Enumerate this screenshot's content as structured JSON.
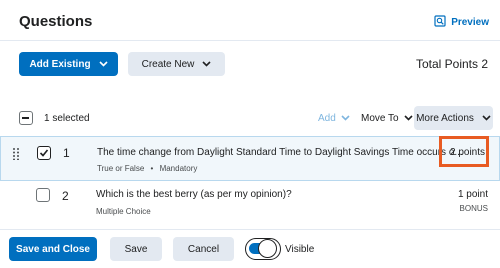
{
  "header": {
    "title": "Questions",
    "preview_label": "Preview"
  },
  "toolbar": {
    "add_existing_label": "Add Existing",
    "create_new_label": "Create New",
    "total_points": "Total Points 2"
  },
  "selection": {
    "selected_text": "1 selected",
    "add_label": "Add",
    "move_to_label": "Move To",
    "more_actions_label": "More Actions"
  },
  "questions": [
    {
      "number": "1",
      "text": "The time change from Daylight Standard Time to Daylight Savings Time occurs o...",
      "type": "True or False",
      "meta": "Mandatory",
      "points": "2 points",
      "checked": true
    },
    {
      "number": "2",
      "text": "Which is the best berry (as per my opinion)?",
      "type": "Multiple Choice",
      "points": "1 point",
      "bonus": "BONUS",
      "checked": false
    }
  ],
  "footer": {
    "save_close_label": "Save and Close",
    "save_label": "Save",
    "cancel_label": "Cancel",
    "visible_label": "Visible",
    "visible_on": true
  },
  "colors": {
    "primary": "#006fbf",
    "secondary": "#e3e9f1",
    "highlight": "#e85b22",
    "selected_row": "#f1f7fb"
  }
}
